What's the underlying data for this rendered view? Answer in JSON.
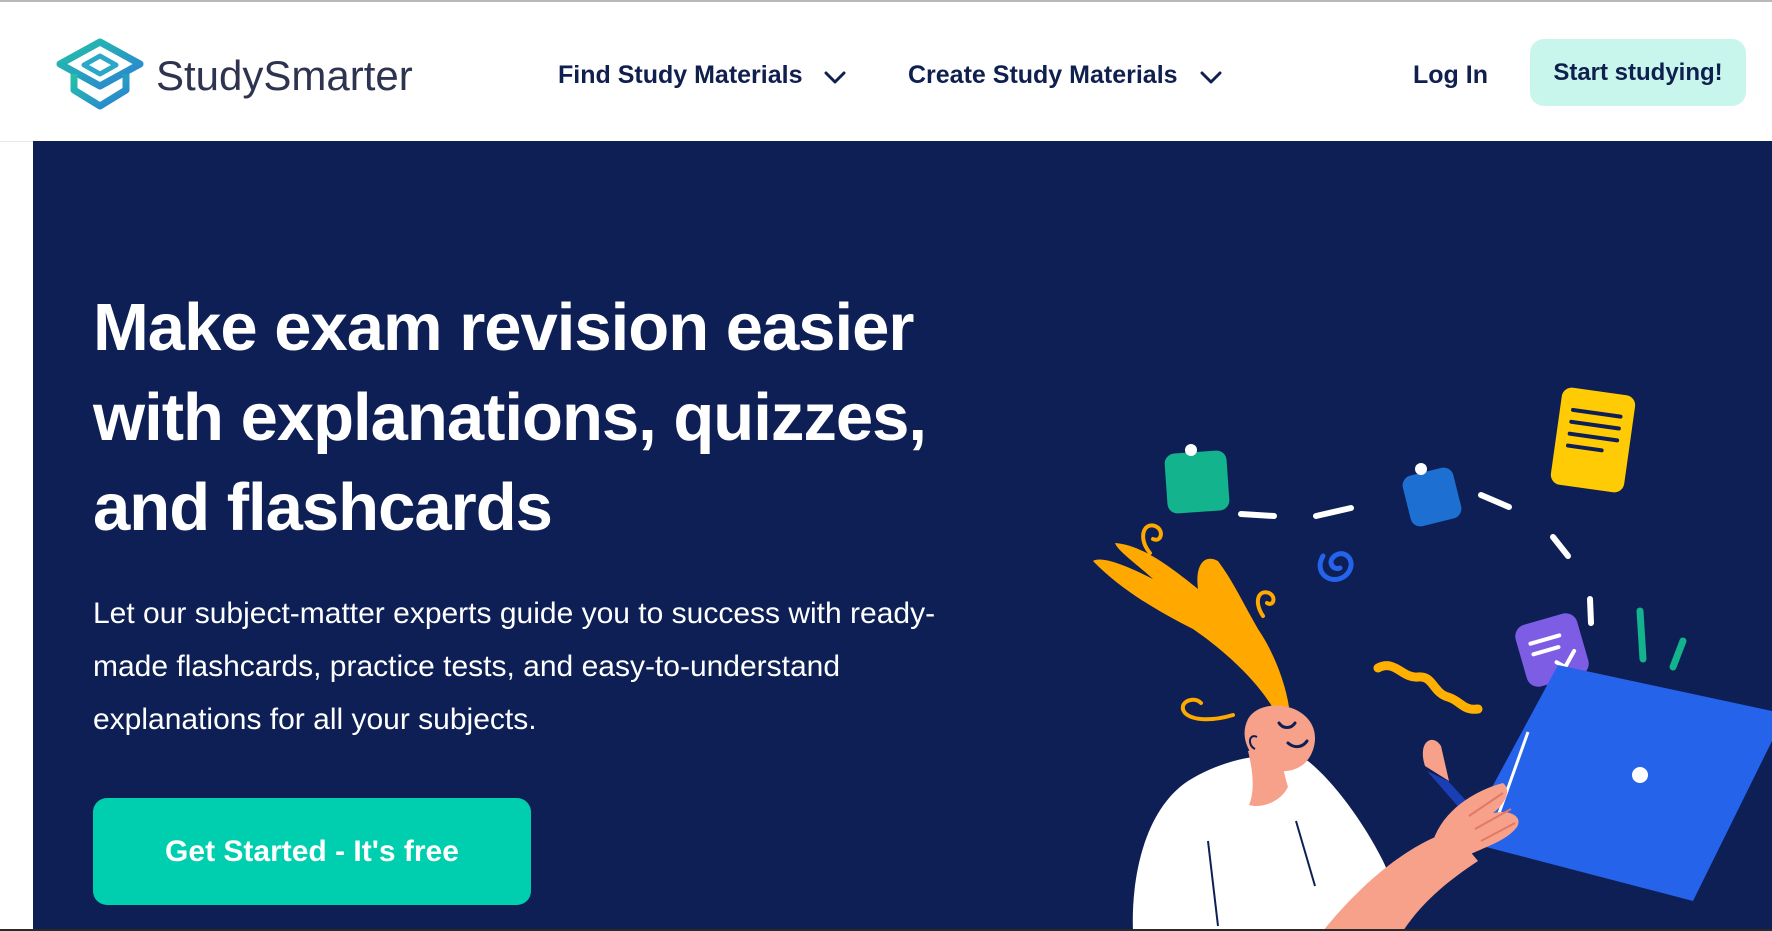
{
  "header": {
    "brand": "StudySmarter",
    "nav": [
      {
        "label": "Find Study Materials"
      },
      {
        "label": "Create Study Materials"
      }
    ],
    "login_label": "Log In",
    "start_label": "Start studying!"
  },
  "hero": {
    "title": "Make exam revision easier with explanations, quizzes, and flashcards",
    "subtitle": "Let our subject-matter experts guide you to success with ready-made flashcards, practice tests, and easy-to-understand explanations for all your subjects.",
    "cta_label": "Get Started - It's free"
  },
  "colors": {
    "hero_background": "#0d1f55",
    "cta": "#00cfaf",
    "start_button": "#c8f6ec",
    "nav_text": "#0f1f4e",
    "hair": "#ffa800",
    "laptop": "#2563eb",
    "skin": "#f7a08a"
  },
  "icons": {
    "logo": "studysmarter-logo-icon",
    "chevrons": "chevron-down-icon"
  }
}
